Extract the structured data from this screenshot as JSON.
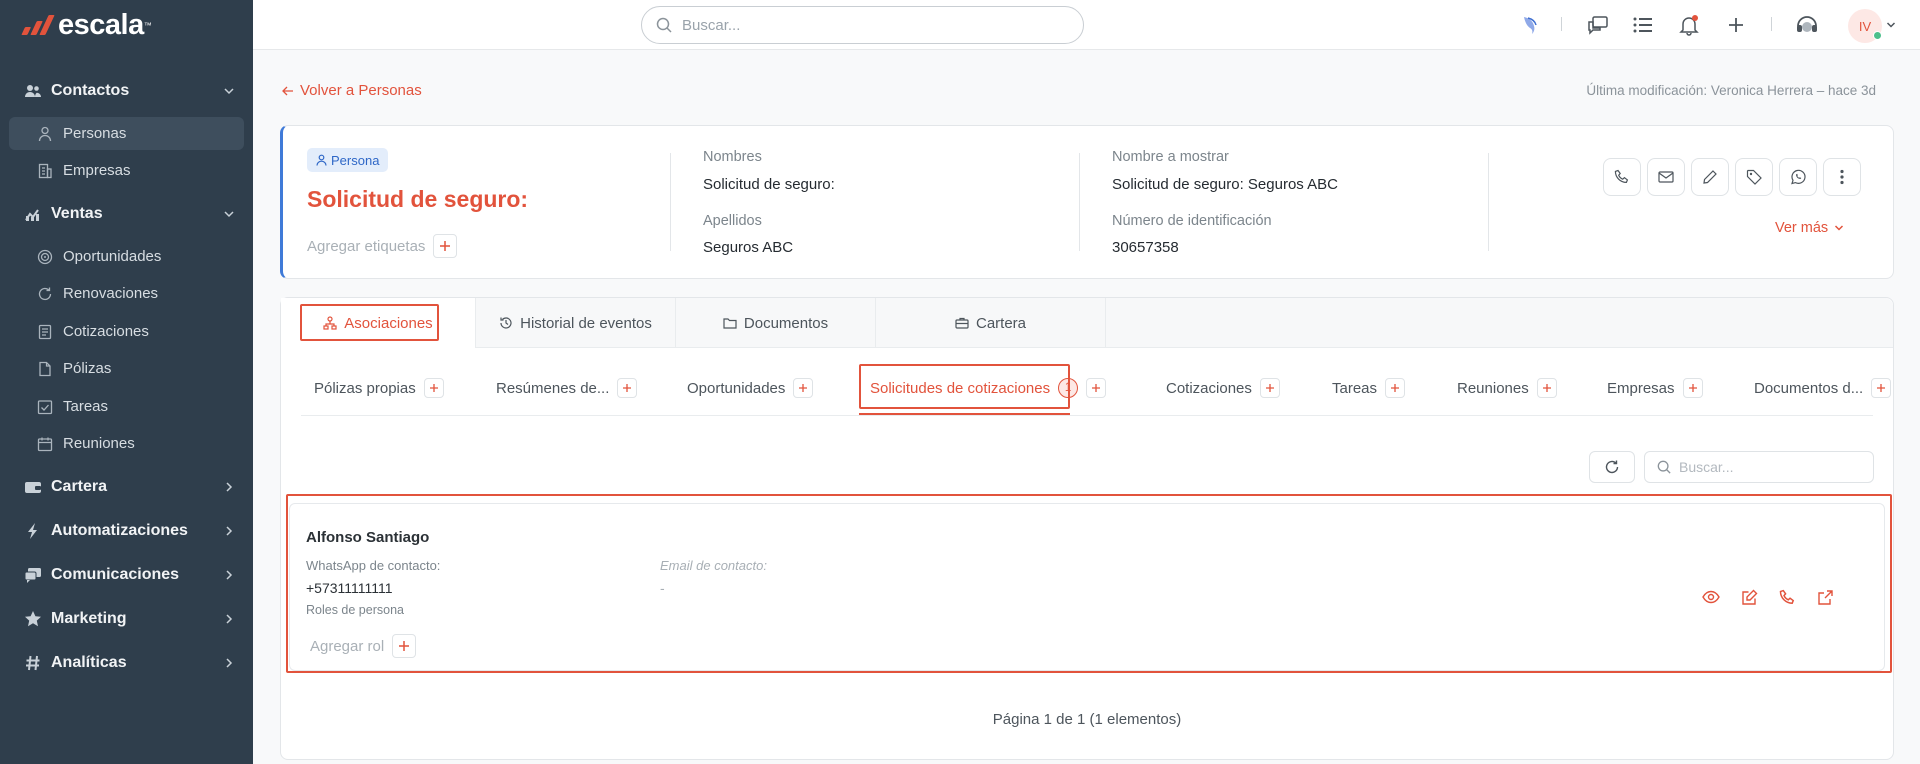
{
  "app": {
    "logo_text": "escala",
    "logo_tm": "™",
    "brand_color": "#e2533c",
    "sidebar_color": "#2f3e4c"
  },
  "sidebar": {
    "sections": [
      {
        "label": "Contactos",
        "icon": "users-icon",
        "expanded": true
      },
      {
        "label": "Ventas",
        "icon": "chart-icon",
        "expanded": true
      },
      {
        "label": "Cartera",
        "icon": "wallet-icon",
        "expanded": false
      },
      {
        "label": "Automatizaciones",
        "icon": "bolt-icon",
        "expanded": false
      },
      {
        "label": "Comunicaciones",
        "icon": "chat-icon",
        "expanded": false
      },
      {
        "label": "Marketing",
        "icon": "star-icon",
        "expanded": false
      },
      {
        "label": "Analíticas",
        "icon": "hash-icon",
        "expanded": false
      }
    ],
    "items": [
      {
        "label": "Personas",
        "icon": "person-icon",
        "active": true
      },
      {
        "label": "Empresas",
        "icon": "building-icon",
        "active": false
      },
      {
        "label": "Oportunidades",
        "icon": "target-icon",
        "active": false
      },
      {
        "label": "Renovaciones",
        "icon": "refresh-icon",
        "active": false
      },
      {
        "label": "Cotizaciones",
        "icon": "document-icon",
        "active": false
      },
      {
        "label": "Pólizas",
        "icon": "file-icon",
        "active": false
      },
      {
        "label": "Tareas",
        "icon": "checkbox-icon",
        "active": false
      },
      {
        "label": "Reuniones",
        "icon": "calendar-icon",
        "active": false
      }
    ]
  },
  "topbar": {
    "search_placeholder": "Buscar...",
    "avatar_initials": "IV"
  },
  "header": {
    "back_label": "Volver a Personas",
    "last_modified": "Última modificación: Veronica Herrera – hace 3d"
  },
  "record": {
    "type_badge": "Persona",
    "title": "Solicitud de seguro:",
    "add_tags_label": "Agregar etiquetas",
    "fields": {
      "nombres_label": "Nombres",
      "nombres_value": "Solicitud de seguro:",
      "apellidos_label": "Apellidos",
      "apellidos_value": "Seguros ABC",
      "nombre_mostrar_label": "Nombre a mostrar",
      "nombre_mostrar_value": "Solicitud de seguro: Seguros ABC",
      "numero_id_label": "Número de identificación",
      "numero_id_value": "30657358"
    },
    "ver_mas_label": "Ver más"
  },
  "main_tabs": [
    {
      "label": "Asociaciones",
      "icon": "org-chart-icon",
      "active": true
    },
    {
      "label": "Historial de eventos",
      "icon": "history-icon",
      "active": false
    },
    {
      "label": "Documentos",
      "icon": "folder-icon",
      "active": false
    },
    {
      "label": "Cartera",
      "icon": "briefcase-icon",
      "active": false
    }
  ],
  "sub_tabs": [
    {
      "label": "Pólizas propias",
      "active": false
    },
    {
      "label": "Resúmenes de...",
      "active": false
    },
    {
      "label": "Oportunidades",
      "active": false
    },
    {
      "label": "Solicitudes de cotizaciones",
      "count": "1",
      "active": true
    },
    {
      "label": "Cotizaciones",
      "active": false
    },
    {
      "label": "Tareas",
      "active": false
    },
    {
      "label": "Reuniones",
      "active": false
    },
    {
      "label": "Empresas",
      "active": false
    },
    {
      "label": "Documentos d...",
      "active": false
    }
  ],
  "list": {
    "search_placeholder": "Buscar...",
    "items": [
      {
        "name": "Alfonso Santiago",
        "whatsapp_label": "WhatsApp de contacto:",
        "whatsapp_value": "+57311111111",
        "email_label": "Email de contacto:",
        "email_value": "-",
        "roles_label": "Roles de persona",
        "add_role_label": "Agregar rol"
      }
    ],
    "pagination": "Página 1 de 1 (1 elementos)"
  }
}
